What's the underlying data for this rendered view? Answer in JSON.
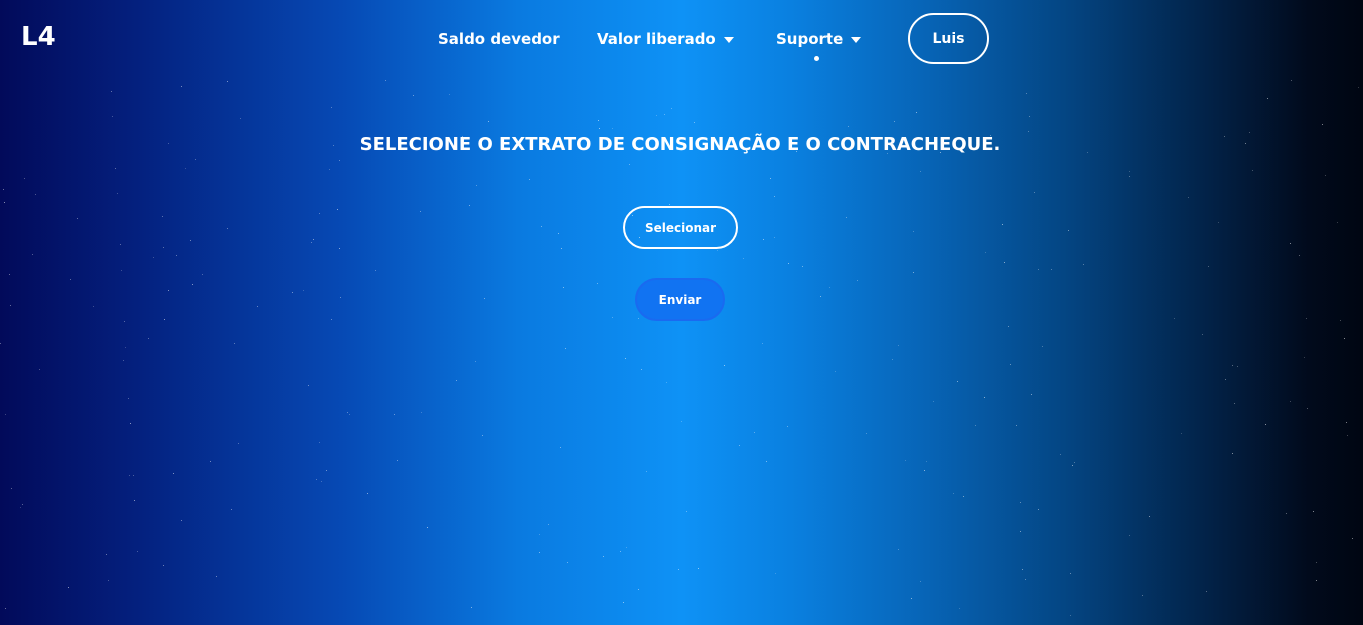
{
  "brand": {
    "logo_text": "L4"
  },
  "nav": {
    "items": [
      {
        "label": "Saldo devedor",
        "has_dropdown": false
      },
      {
        "label": "Valor liberado",
        "has_dropdown": true,
        "icon": "caret-down-icon"
      },
      {
        "label": "Suporte",
        "has_dropdown": true,
        "icon": "caret-down-icon",
        "active": true
      }
    ],
    "user_label": "Luis"
  },
  "main": {
    "title": "SELECIONE O EXTRATO DE CONSIGNAÇÃO E O CONTRACHEQUE.",
    "select_label": "Selecionar",
    "send_label": "Enviar"
  },
  "colors": {
    "background_gradient": [
      "#020a5a",
      "#0e92f6",
      "#000612"
    ],
    "send_button": "#1173f2",
    "text": "#ffffff"
  }
}
